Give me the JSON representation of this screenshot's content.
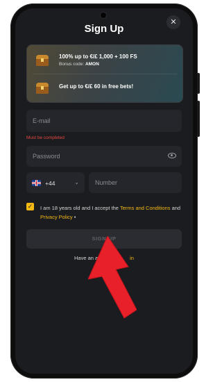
{
  "header": {
    "title": "Sign Up",
    "close_glyph": "✕"
  },
  "promo": {
    "line1": "100% up to €/£ 1,000 + 100 FS",
    "bonus_label": "Bonus code:",
    "bonus_code": "AMON",
    "line3": "Get up to €/£ 60 in free bets!",
    "icons": [
      "treasure-chest-icon",
      "treasure-chest-icon"
    ]
  },
  "form": {
    "email_placeholder": "E-mail",
    "email_error": "Must be completed",
    "password_placeholder": "Password",
    "country_code": "+44",
    "number_placeholder": "Number",
    "chevron_glyph": "⌄",
    "checkbox_checked": true,
    "checkbox_glyph": "✓",
    "terms_prefix": "I am 18 years old and I accept the",
    "terms_link": "Terms and Conditions",
    "terms_and": "and",
    "privacy_link": "Privacy Policy",
    "terms_suffix": "•",
    "signup_label": "SIGN UP",
    "have_account_prefix": "Have an ac",
    "have_account_link": "in"
  },
  "colors": {
    "accent": "#f5b914",
    "error": "#e5483f",
    "background": "#1b1c20",
    "field": "#24262b",
    "arrow": "#e8202a"
  }
}
